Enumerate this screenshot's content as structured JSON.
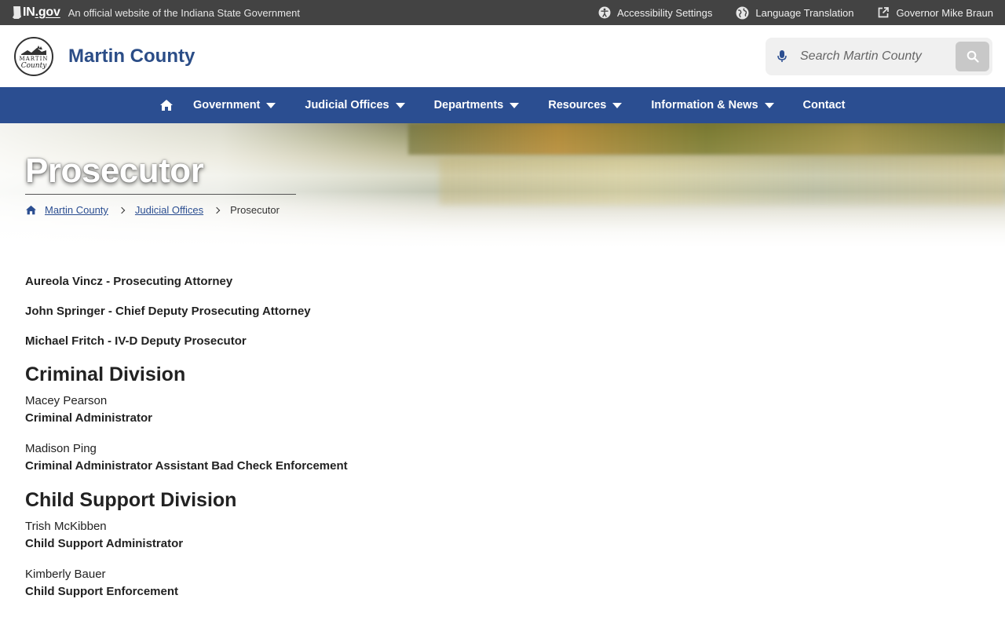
{
  "statebar": {
    "logo_in": "IN",
    "logo_gov": ".gov",
    "official_text": "An official website of the Indiana State Government",
    "links": [
      {
        "label": "Accessibility Settings",
        "icon": "accessibility-icon"
      },
      {
        "label": "Language Translation",
        "icon": "globe-icon"
      },
      {
        "label": "Governor Mike Braun",
        "icon": "external-link-icon"
      }
    ]
  },
  "header": {
    "seal_text": "MARTIN",
    "seal_script": "County",
    "site_title": "Martin County",
    "search_placeholder": "Search Martin County"
  },
  "nav": {
    "items": [
      {
        "label": "Government",
        "dropdown": true
      },
      {
        "label": "Judicial Offices",
        "dropdown": true
      },
      {
        "label": "Departments",
        "dropdown": true
      },
      {
        "label": "Resources",
        "dropdown": true
      },
      {
        "label": "Information & News",
        "dropdown": true
      },
      {
        "label": "Contact",
        "dropdown": false
      }
    ]
  },
  "hero": {
    "title": "Prosecutor",
    "breadcrumb": [
      {
        "label": "Martin County"
      },
      {
        "label": "Judicial Offices"
      },
      {
        "label": "Prosecutor"
      }
    ]
  },
  "content": {
    "leadership": [
      "Aureola Vincz - Prosecuting Attorney",
      "John Springer - Chief Deputy Prosecuting Attorney",
      "Michael Fritch - IV-D Deputy Prosecutor"
    ],
    "divisions": [
      {
        "title": "Criminal Division",
        "people": [
          {
            "name": "Macey Pearson",
            "role": "Criminal Administrator"
          },
          {
            "name": "Madison Ping",
            "role": "Criminal Administrator Assistant Bad Check Enforcement"
          }
        ]
      },
      {
        "title": "Child Support Division",
        "people": [
          {
            "name": "Trish McKibben",
            "role": "Child Support Administrator"
          },
          {
            "name": "Kimberly Bauer",
            "role": "Child Support Enforcement"
          }
        ]
      }
    ]
  },
  "colors": {
    "statebar_bg": "#434343",
    "brand_blue": "#2b4e91",
    "title_blue": "#2b4d87"
  }
}
